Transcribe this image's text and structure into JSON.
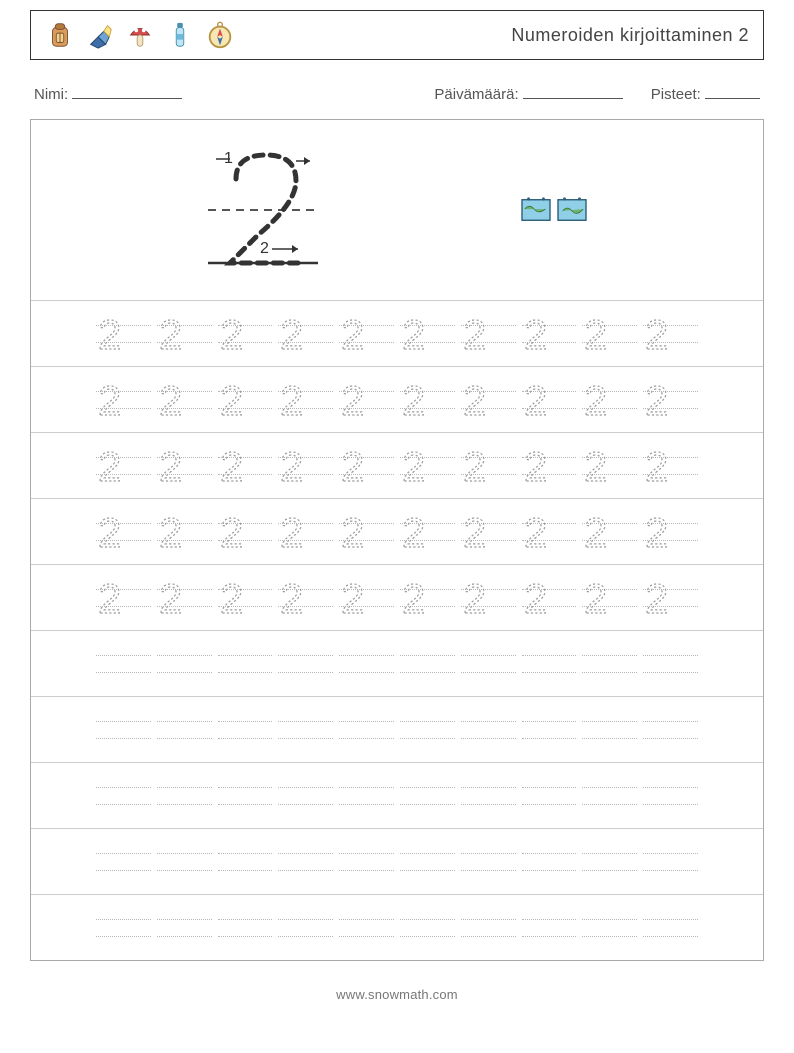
{
  "header": {
    "icons": [
      "backpack-icon",
      "flashlight-icon",
      "mushroom-icon",
      "water-bottle-icon",
      "compass-icon"
    ],
    "title": "Numeroiden kirjoittaminen 2"
  },
  "meta": {
    "name_label": "Nimi:",
    "date_label": "Päivämäärä:",
    "score_label": "Pisteet:"
  },
  "intro": {
    "stroke_labels": [
      "1",
      "2"
    ],
    "image_icons": [
      "world-map-icon",
      "world-map-icon"
    ]
  },
  "tracing": {
    "digit": "2",
    "rows": 10,
    "cells_per_row": 10,
    "traced_rows": 5
  },
  "footer": {
    "site": "www.snowmath.com"
  }
}
